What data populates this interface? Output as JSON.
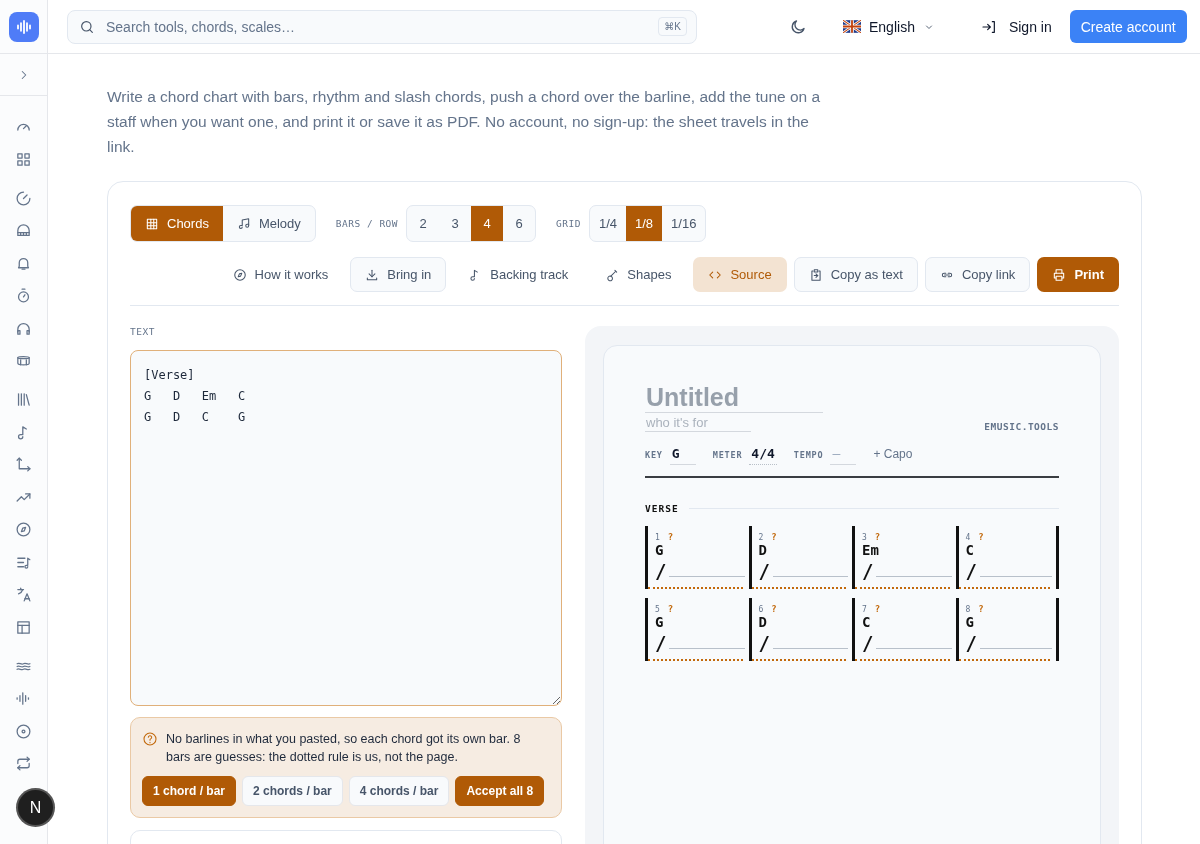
{
  "header": {
    "search_placeholder": "Search tools, chords, scales…",
    "shortcut": "⌘K",
    "language": "English",
    "sign_in": "Sign in",
    "create_account": "Create account"
  },
  "page": {
    "intro": "Write a chord chart with bars, rhythm and slash chords, push a chord over the barline, add the tune on a staff when you want one, and print it or save it as PDF. No account, no sign-up: the sheet travels in the link."
  },
  "mode_tabs": [
    {
      "label": "Chords",
      "selected": true
    },
    {
      "label": "Melody",
      "selected": false
    }
  ],
  "bars_per_row": {
    "label": "BARS / ROW",
    "options": [
      {
        "label": "2",
        "selected": false
      },
      {
        "label": "3",
        "selected": false
      },
      {
        "label": "4",
        "selected": true
      },
      {
        "label": "6",
        "selected": false
      }
    ]
  },
  "grid": {
    "label": "GRID",
    "options": [
      {
        "label": "1/4",
        "selected": false
      },
      {
        "label": "1/8",
        "selected": true
      },
      {
        "label": "1/16",
        "selected": false
      }
    ]
  },
  "actions": [
    {
      "label": "How it works",
      "kind": "plain"
    },
    {
      "label": "Bring in",
      "kind": "outline"
    },
    {
      "label": "Backing track",
      "kind": "plain"
    },
    {
      "label": "Shapes",
      "kind": "plain"
    },
    {
      "label": "Source",
      "kind": "active"
    },
    {
      "label": "Copy as text",
      "kind": "outline"
    },
    {
      "label": "Copy link",
      "kind": "outline"
    },
    {
      "label": "Print",
      "kind": "primary"
    }
  ],
  "editor": {
    "label": "TEXT",
    "value": "[Verse]\nG   D   Em   C\nG   D   C    G"
  },
  "notice": {
    "text": "No barlines in what you pasted, so each chord got its own bar. 8 bars are guesses: the dotted rule is us, not the page.",
    "buttons": [
      {
        "label": "1 chord / bar",
        "selected": true
      },
      {
        "label": "2 chords / bar",
        "selected": false
      },
      {
        "label": "4 chords / bar",
        "selected": false
      },
      {
        "label": "Accept all 8",
        "selected": true
      }
    ]
  },
  "sheet": {
    "title_placeholder": "Untitled",
    "subtitle_placeholder": "who it's for",
    "brand": "EMUSIC.TOOLS",
    "key_label": "KEY",
    "key": "G",
    "meter_label": "METER",
    "meter": "4/4",
    "tempo_label": "TEMPO",
    "tempo": "—",
    "capo": "+ Capo",
    "sections": [
      {
        "name": "VERSE",
        "bars": [
          {
            "number": "1",
            "flag": "?",
            "chord": "G",
            "slash": "/",
            "guessed": true
          },
          {
            "number": "2",
            "flag": "?",
            "chord": "D",
            "slash": "/",
            "guessed": true
          },
          {
            "number": "3",
            "flag": "?",
            "chord": "Em",
            "slash": "/",
            "guessed": true
          },
          {
            "number": "4",
            "flag": "?",
            "chord": "C",
            "slash": "/",
            "guessed": true
          },
          {
            "number": "5",
            "flag": "?",
            "chord": "G",
            "slash": "/",
            "guessed": true
          },
          {
            "number": "6",
            "flag": "?",
            "chord": "D",
            "slash": "/",
            "guessed": true
          },
          {
            "number": "7",
            "flag": "?",
            "chord": "C",
            "slash": "/",
            "guessed": true
          },
          {
            "number": "8",
            "flag": "?",
            "chord": "G",
            "slash": "/",
            "guessed": true
          }
        ]
      }
    ]
  },
  "avatar": "N"
}
